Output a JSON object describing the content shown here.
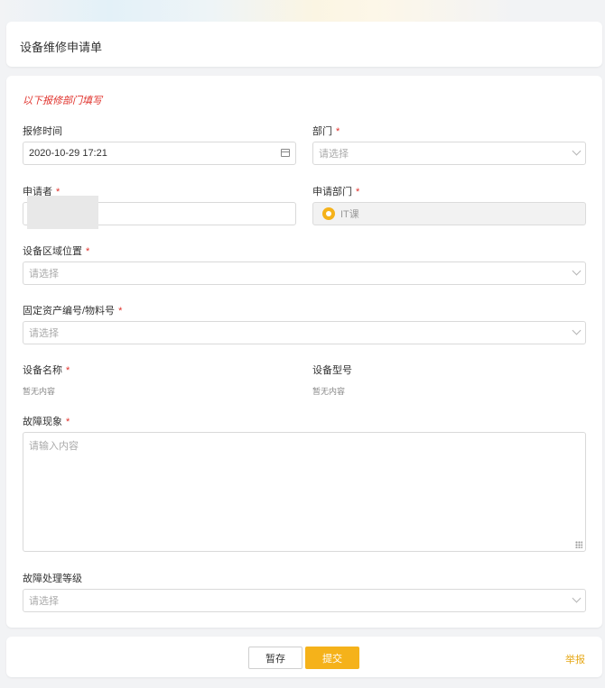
{
  "header": {
    "title": "设备维修申请单"
  },
  "form": {
    "section_note": "以下报修部门填写",
    "repair_time": {
      "label": "报修时间",
      "value": "2020-10-29 17:21"
    },
    "department": {
      "label": "部门",
      "required_mark": "*",
      "placeholder": "请选择"
    },
    "applicant": {
      "label": "申请者",
      "required_mark": "*",
      "value": ""
    },
    "applicant_dept": {
      "label": "申请部门",
      "required_mark": "*",
      "value": "IT课"
    },
    "area_location": {
      "label": "设备区域位置",
      "required_mark": "*",
      "placeholder": "请选择"
    },
    "asset_number": {
      "label": "固定资产编号/物料号",
      "required_mark": "*",
      "placeholder": "请选择"
    },
    "device_name": {
      "label": "设备名称",
      "required_mark": "*",
      "empty_text": "暂无内容"
    },
    "device_model": {
      "label": "设备型号",
      "empty_text": "暂无内容"
    },
    "fault_phenomenon": {
      "label": "故障现象",
      "required_mark": "*",
      "placeholder": "请输入内容"
    },
    "fault_level": {
      "label": "故障处理等级",
      "placeholder": "请选择"
    }
  },
  "footer": {
    "save_label": "暂存",
    "submit_label": "提交",
    "report_label": "举报"
  },
  "colors": {
    "accent": "#f5b21a",
    "required": "#e0302a",
    "background": "#f2f3f5"
  }
}
